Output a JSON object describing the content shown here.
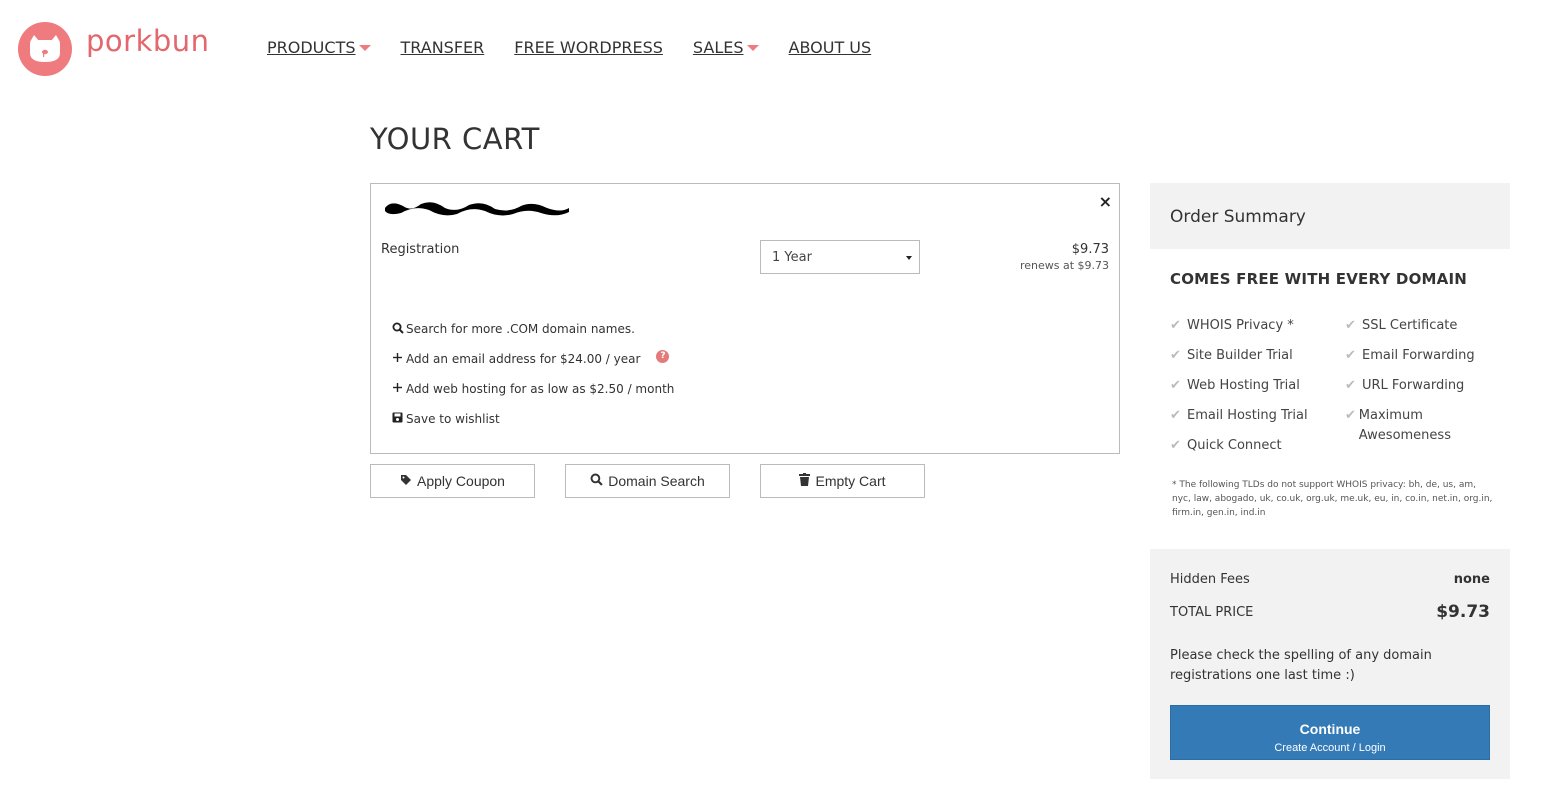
{
  "brand": {
    "name": "porkbun",
    "color": "#ef7b7e"
  },
  "nav": [
    {
      "label": "PRODUCTS",
      "dropdown": true
    },
    {
      "label": "TRANSFER",
      "dropdown": false
    },
    {
      "label": "FREE WORDPRESS",
      "dropdown": false
    },
    {
      "label": "SALES",
      "dropdown": true
    },
    {
      "label": "ABOUT US",
      "dropdown": false
    }
  ],
  "cart": {
    "title": "YOUR CART",
    "item": {
      "registration_label": "Registration",
      "term_selected": "1 Year",
      "price": "$9.73",
      "renews": "renews at $9.73",
      "remove_label": "×"
    },
    "links": [
      {
        "icon": "search-icon",
        "text": "Search for more .COM domain names."
      },
      {
        "icon": "plus-icon",
        "text": "Add an email address for $24.00 / year"
      },
      {
        "icon": "plus-icon",
        "text": "Add web hosting for as low as $2.50 / month"
      },
      {
        "icon": "save-icon",
        "text": "Save to wishlist"
      }
    ],
    "buttons": {
      "apply_coupon": "Apply Coupon",
      "domain_search": "Domain Search",
      "empty_cart": "Empty Cart"
    }
  },
  "summary": {
    "title": "Order Summary",
    "free_title": "COMES FREE WITH EVERY DOMAIN",
    "features": [
      "WHOIS Privacy *",
      "Site Builder Trial",
      "Web Hosting Trial",
      "Email Hosting Trial",
      "Quick Connect",
      "SSL Certificate",
      "Email Forwarding",
      "URL Forwarding",
      "Maximum Awesomeness"
    ],
    "whois_note": "* The following TLDs do not support WHOIS privacy: bh, de, us, am, nyc, law, abogado, uk, co.uk, org.uk, me.uk, eu, in, co.in, net.in, org.in, firm.in, gen.in, ind.in",
    "hidden_fees_label": "Hidden Fees",
    "hidden_fees_value": "none",
    "total_label": "TOTAL PRICE",
    "total_value": "$9.73",
    "spell_note": "Please check the spelling of any domain registrations one last time :)",
    "continue_label": "Continue",
    "continue_sub": "Create Account / Login"
  }
}
